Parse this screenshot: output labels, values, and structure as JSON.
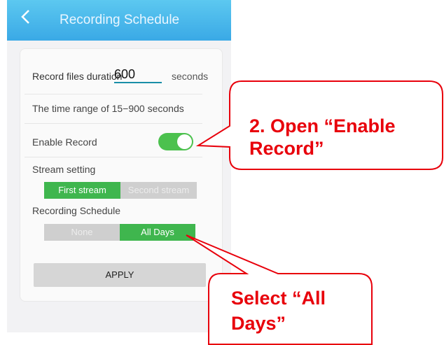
{
  "header": {
    "title": "Recording Schedule"
  },
  "duration": {
    "label": "Record files duration",
    "value": "600",
    "unit": "seconds"
  },
  "range_hint": "The time range of 15−900 seconds",
  "enable_record": {
    "label": "Enable Record",
    "on": true
  },
  "stream": {
    "label": "Stream setting",
    "options": [
      "First stream",
      "Second stream"
    ],
    "selected": "First stream"
  },
  "schedule": {
    "label": "Recording Schedule",
    "options": [
      "None",
      "All Days"
    ],
    "selected": "All Days"
  },
  "apply_label": "APPLY",
  "callouts": {
    "enable_line1": "2. Open “Enable",
    "enable_line2": "Record”",
    "days_line1": "Select “All",
    "days_line2": "Days”"
  },
  "colors": {
    "header": "#3aa9e6",
    "accent_green": "#3fb64e",
    "callout_red": "#e8000b"
  }
}
